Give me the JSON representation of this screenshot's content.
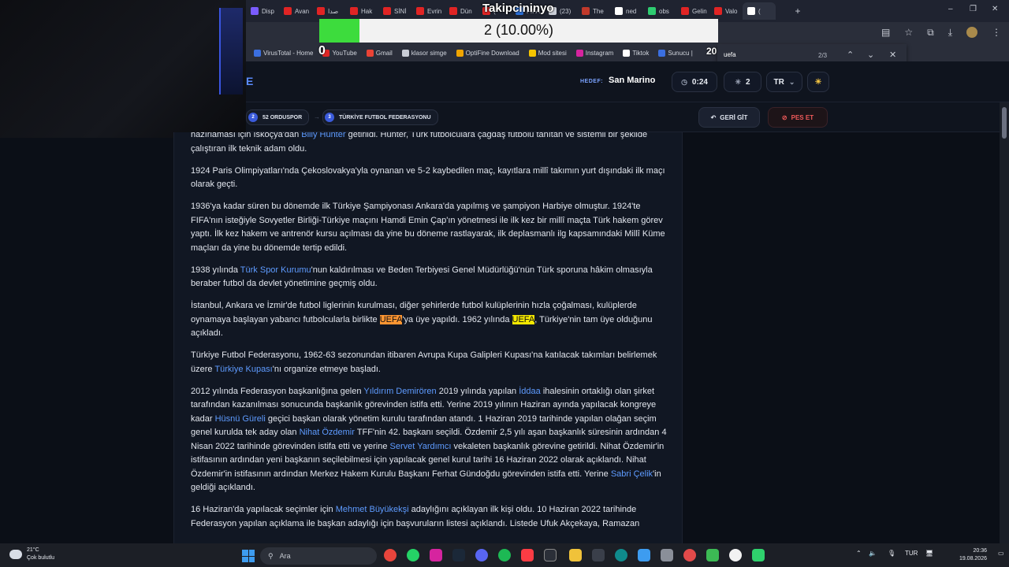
{
  "browser": {
    "tabs": [
      {
        "label": "Disp",
        "color": "#7a5cff"
      },
      {
        "label": "Avan",
        "color": "#e02424"
      },
      {
        "label": "صدا",
        "color": "#e02424"
      },
      {
        "label": "Hak",
        "color": "#e02424"
      },
      {
        "label": "SİNİ",
        "color": "#e02424"
      },
      {
        "label": "Evrin",
        "color": "#e02424"
      },
      {
        "label": "Dün",
        "color": "#e02424"
      },
      {
        "label": "(",
        "color": "#e02424"
      },
      {
        "label": "FIFA",
        "color": "#2b6fd8"
      },
      {
        "label": "(23)",
        "color": "#c9cdd6"
      },
      {
        "label": "The",
        "color": "#c0392b"
      },
      {
        "label": "ned",
        "color": "#ffffff"
      },
      {
        "label": "obs",
        "color": "#2ecc71"
      },
      {
        "label": "Gelin",
        "color": "#e02424"
      },
      {
        "label": "Valo",
        "color": "#e02424"
      },
      {
        "label": "(",
        "color": "#ffffff",
        "active": true
      }
    ],
    "new_tab": "+",
    "window_controls": [
      "–",
      "❐",
      "✕"
    ],
    "bookmarks": [
      {
        "label": "VirusTotal - Home",
        "color": "#3b6fe0"
      },
      {
        "label": "YouTube",
        "color": "#e02424"
      },
      {
        "label": "Gmail",
        "color": "#ea4335"
      },
      {
        "label": "klasor simge",
        "color": "#c9cdd6"
      },
      {
        "label": "OptiFine Download",
        "color": "#f0a500"
      },
      {
        "label": "Mod sitesi",
        "color": "#f5c400"
      },
      {
        "label": "Instagram",
        "color": "#d6249f"
      },
      {
        "label": "Tiktok",
        "color": "#ffffff"
      },
      {
        "label": "Sunucu |",
        "color": "#3b6fe0"
      }
    ]
  },
  "overlay": {
    "title": "Takipcininyo",
    "progress_text": "2 (10.00%)",
    "progress_fraction": 0.1,
    "left_number": "0",
    "right_number": "20"
  },
  "find": {
    "query": "uefa",
    "count": "2/3",
    "prev": "⌃",
    "next": "⌄",
    "close": "✕"
  },
  "site": {
    "logo_fragment": "E",
    "hedef_label": "HEDEF:",
    "hedef_value": "San Marino",
    "timer": "0:24",
    "clicks": "2",
    "lang": "TR",
    "path": [
      {
        "num": "2",
        "label": "52 ORDUSPOR"
      },
      {
        "num": "3",
        "label": "TÜRKİYE FUTBOL FEDERASYONU"
      }
    ],
    "back_button": "GERİ GİT",
    "give_up_button": "PES ET"
  },
  "article": {
    "p1_a": "hazırlaması için İskoçya'dan ",
    "p1_link": "Billy Hunter",
    "p1_b": " getirildi. Hunter, Türk futbolculara çağdaş futbolu tanıtan ve sistemli bir şekilde çalıştıran ilk teknik adam oldu.",
    "p2": "1924 Paris Olimpiyatları'nda Çekoslovakya'yla oynanan ve 5-2 kaybedilen maç, kayıtlara millî takımın yurt dışındaki ilk maçı olarak geçti.",
    "p3": "1936'ya kadar süren bu dönemde ilk Türkiye Şampiyonası Ankara'da yapılmış ve şampiyon Harbiye olmuştur. 1924'te FIFA'nın isteğiyle Sovyetler Birliği-Türkiye maçını Hamdi Emin Çap'ın yönetmesi ile ilk kez bir millî maçta Türk hakem görev yaptı. İlk kez hakem ve antrenör kursu açılması da yine bu döneme rastlayarak, ilk deplasmanlı ilg kapsamındaki Millî Küme maçları da yine bu dönemde tertip edildi.",
    "p4_a": "1938 yılında ",
    "p4_link": "Türk Spor Kurumu",
    "p4_b": "'nun kaldırılması ve Beden Terbiyesi Genel Müdürlüğü'nün Türk sporuna hâkim olmasıyla beraber futbol da devlet yönetimine geçmiş oldu.",
    "p5_a": "İstanbul, Ankara ve İzmir'de futbol liglerinin kurulması, diğer şehirlerde futbol kulüplerinin hızla çoğalması, kulüplerde oynamaya başlayan yabancı futbolcularla birlikte ",
    "p5_hl1": "UEFA",
    "p5_b": "'ya üye yapıldı. 1962 yılında ",
    "p5_hl2": "UEFA",
    "p5_c": ", Türkiye'nin tam üye olduğunu açıkladı.",
    "p6_a": "Türkiye Futbol Federasyonu, 1962-63 sezonundan itibaren Avrupa Kupa Galipleri Kupası'na katılacak takımları belirlemek üzere ",
    "p6_link": "Türkiye Kupası",
    "p6_b": "'nı organize etmeye başladı.",
    "p7_a": "2012 yılında Federasyon başkanlığına gelen ",
    "p7_l1": "Yıldırım Demirören",
    "p7_b": " 2019 yılında yapılan ",
    "p7_l2": "İddaa",
    "p7_c": " ihalesinin ortaklığı olan şirket tarafından kazanılması sonucunda başkanlık görevinden istifa etti. Yerine 2019 yılının Haziran ayında yapılacak kongreye kadar ",
    "p7_l3": "Hüsnü Güreli",
    "p7_d": " geçici başkan olarak yönetim kurulu tarafından atandı. 1 Haziran 2019 tarihinde yapılan olağan seçim genel kurulda tek aday olan ",
    "p7_l4": "Nihat Özdemir",
    "p7_e": " TFF'nin 42. başkanı seçildi. Özdemir 2,5 yılı aşan başkanlık süresinin ardından 4 Nisan 2022 tarihinde görevinden istifa etti ve yerine ",
    "p7_l5": "Servet Yardımcı",
    "p7_f": " vekaleten başkanlık görevine getirildi. Nihat Özdemir'in istifasının ardından yeni başkanın seçilebilmesi için yapılacak genel kurul tarihi 16 Haziran 2022 olarak açıklandı. Nihat Özdemir'in istifasının ardından Merkez Hakem Kurulu Başkanı Ferhat Gündoğdu görevinden istifa etti. Yerine ",
    "p7_l6": "Sabri Çelik",
    "p7_g": "'in geldiği açıklandı.",
    "p8_a": "16 Haziran'da yapılacak seçimler için ",
    "p8_link": "Mehmet Büyükekşi",
    "p8_b": " adaylığını açıklayan ilk kişi oldu. 10 Haziran 2022 tarihinde Federasyon yapılan açıklama ile başkan adaylığı için başvuruların listesi açıklandı. Listede Ufuk Akçekaya, Ramazan"
  },
  "taskbar": {
    "weather_temp": "21°C",
    "weather_desc": "Çok bulutlu",
    "search_placeholder": "Ara",
    "lang": "TUR",
    "time": "20:36",
    "date": "19.08.2026"
  }
}
